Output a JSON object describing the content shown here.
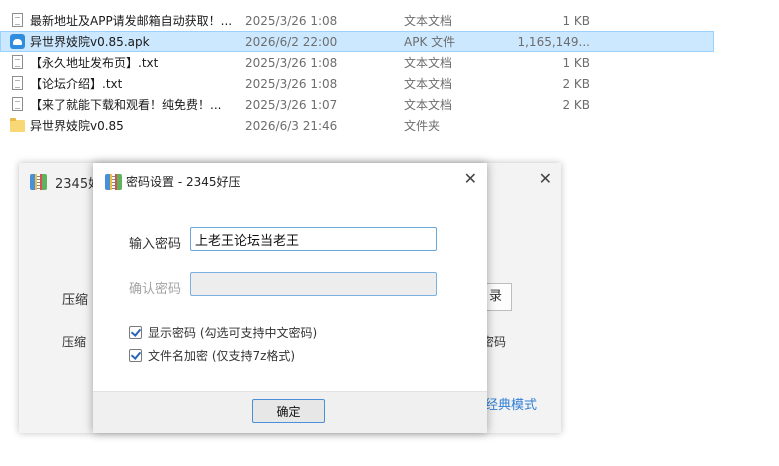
{
  "files": [
    {
      "icon": "text-file-icon",
      "name": "最新地址及APP请发邮箱自动获取！...",
      "date": "2025/3/26 1:08",
      "type": "文本文档",
      "size": "1 KB",
      "selected": false
    },
    {
      "icon": "apk-file-icon",
      "name": "异世界妓院v0.85.apk",
      "date": "2026/6/2 22:00",
      "type": "APK 文件",
      "size": "1,165,149...",
      "selected": true
    },
    {
      "icon": "text-file-icon",
      "name": "【永久地址发布页】.txt",
      "date": "2025/3/26 1:08",
      "type": "文本文档",
      "size": "1 KB",
      "selected": false
    },
    {
      "icon": "text-file-icon",
      "name": "【论坛介绍】.txt",
      "date": "2025/3/26 1:08",
      "type": "文本文档",
      "size": "2 KB",
      "selected": false
    },
    {
      "icon": "text-file-icon",
      "name": "【来了就能下载和观看！纯免费！...",
      "date": "2025/3/26 1:07",
      "type": "文本文档",
      "size": "2 KB",
      "selected": false
    },
    {
      "icon": "folder-icon",
      "name": "异世界妓院v0.85",
      "date": "2026/6/3 21:46",
      "type": "文件夹",
      "size": "",
      "selected": false
    }
  ],
  "bg_window": {
    "title": "2345好",
    "label_compress": "压缩",
    "label_compress2": "压缩",
    "browse_button_partial": "录",
    "option_partial": "密码",
    "classic_mode_link": "经典模式"
  },
  "dialog": {
    "title": "密码设置 - 2345好压",
    "password_label": "输入密码",
    "password_value": "上老王论坛当老王",
    "confirm_label": "确认密码",
    "confirm_value": "",
    "show_password_label": "显示密码 (勾选可支持中文密码)",
    "show_password_checked": true,
    "encrypt_filename_label": "文件名加密  (仅支持7z格式)",
    "encrypt_filename_checked": true,
    "ok_button": "确定"
  },
  "colors": {
    "selection_bg": "#cce8ff",
    "selection_border": "#99d1ff",
    "input_focus_border": "#6aa7dc",
    "link": "#2f7fd6",
    "checkmark": "#2b66b6"
  }
}
